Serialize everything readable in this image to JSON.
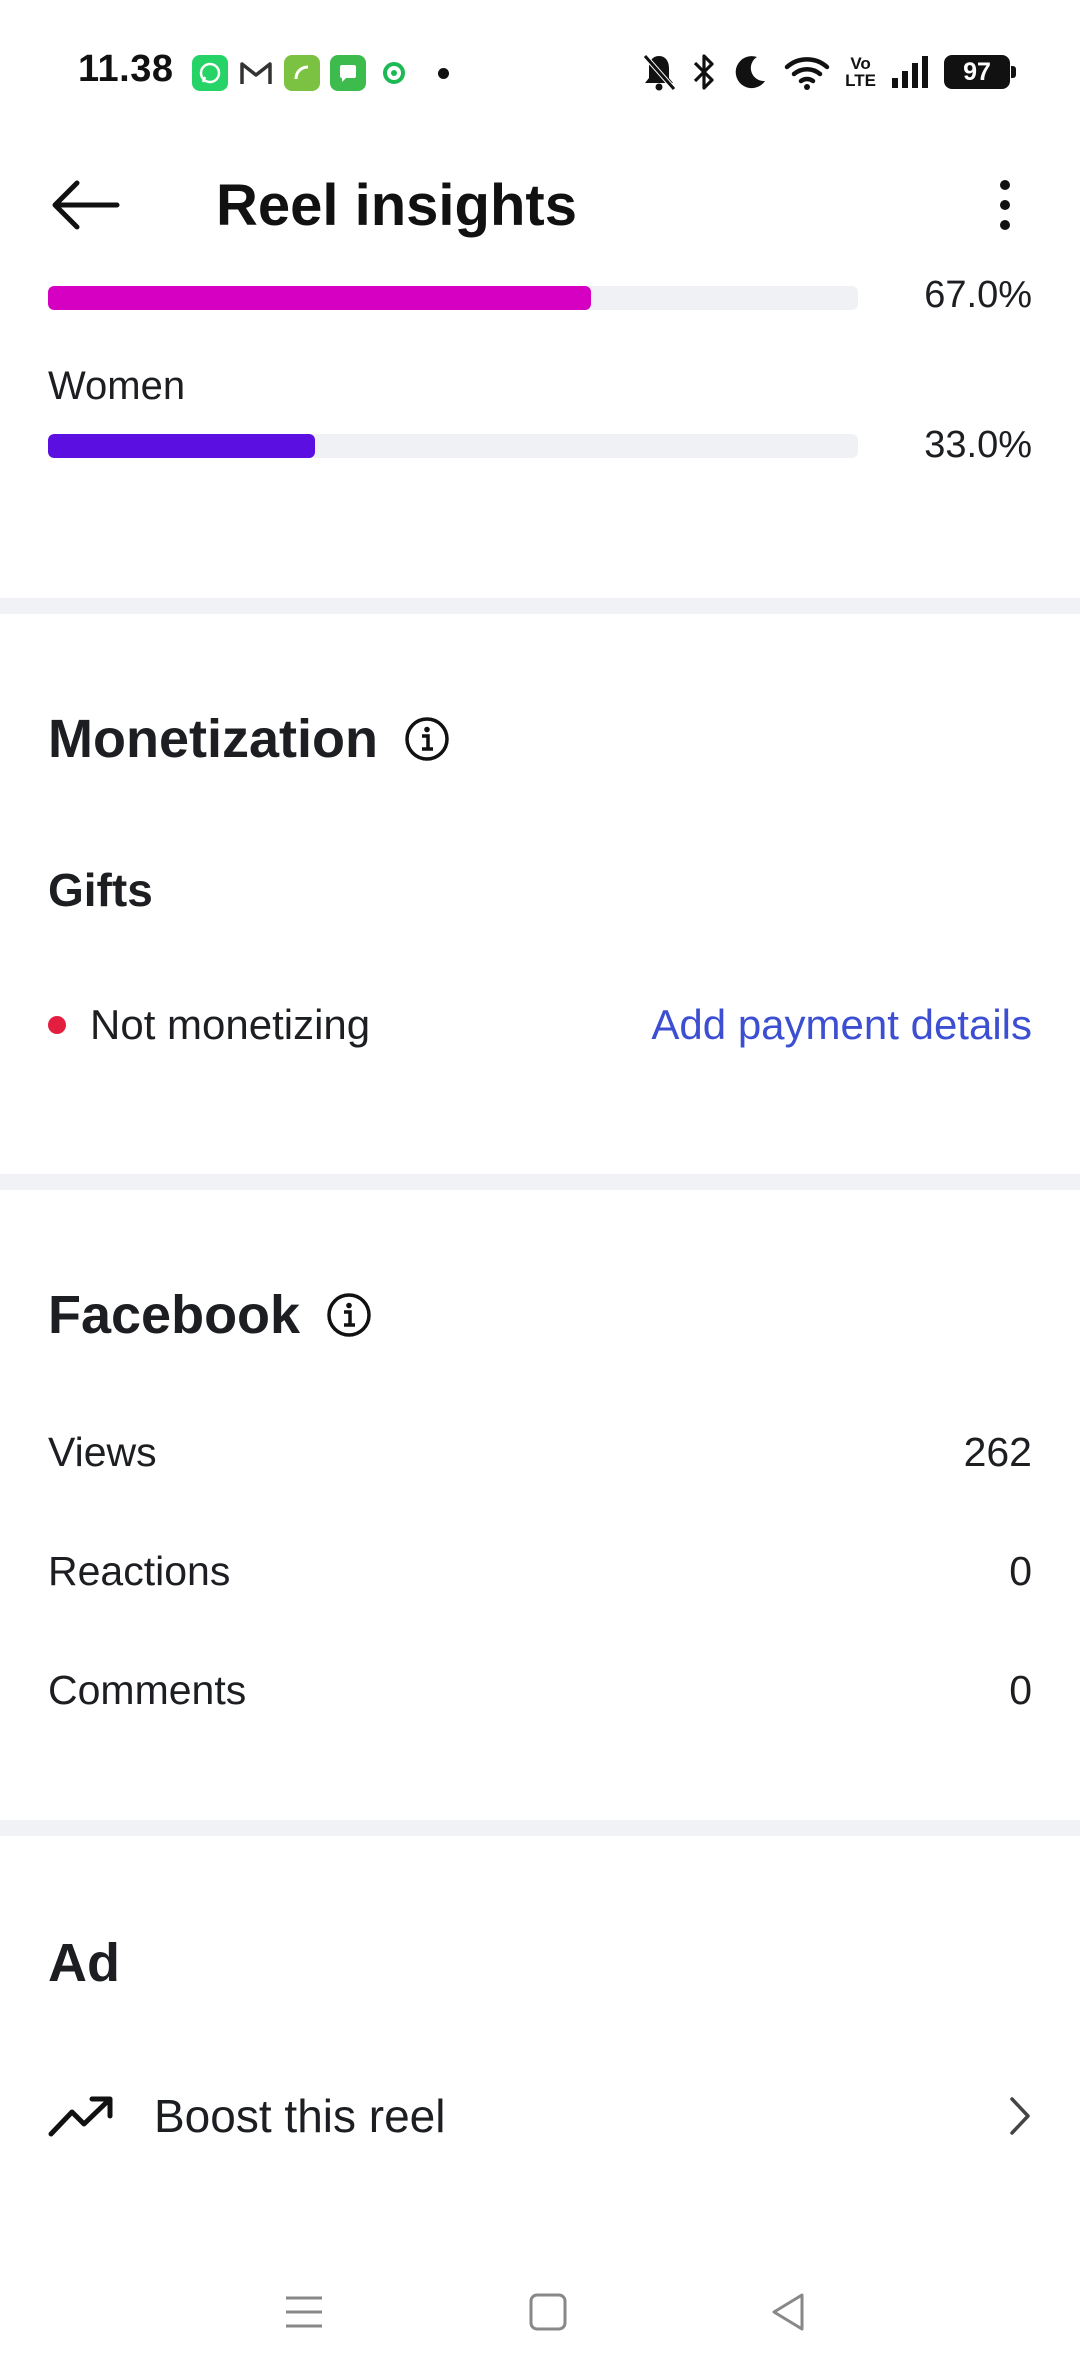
{
  "status_bar": {
    "time": "11.38",
    "network_label": "Vo\nLTE",
    "battery": "97"
  },
  "header": {
    "title": "Reel insights"
  },
  "gender": {
    "men": {
      "percent_label": "67.0%",
      "fill": 0.67,
      "color": "#d500c2"
    },
    "women": {
      "label": "Women",
      "percent_label": "33.0%",
      "fill": 0.33,
      "color": "#5b0fe0"
    }
  },
  "monetization": {
    "title": "Monetization",
    "gifts_title": "Gifts",
    "status": "Not monetizing",
    "action_link": "Add payment details"
  },
  "facebook": {
    "title": "Facebook",
    "metrics": [
      {
        "label": "Views",
        "value": "262"
      },
      {
        "label": "Reactions",
        "value": "0"
      },
      {
        "label": "Comments",
        "value": "0"
      }
    ]
  },
  "ad": {
    "title": "Ad",
    "boost_label": "Boost this reel"
  },
  "colors": {
    "link": "#3c4ed1",
    "status_dot": "#e41e3f",
    "divider": "#f0f2f5"
  }
}
